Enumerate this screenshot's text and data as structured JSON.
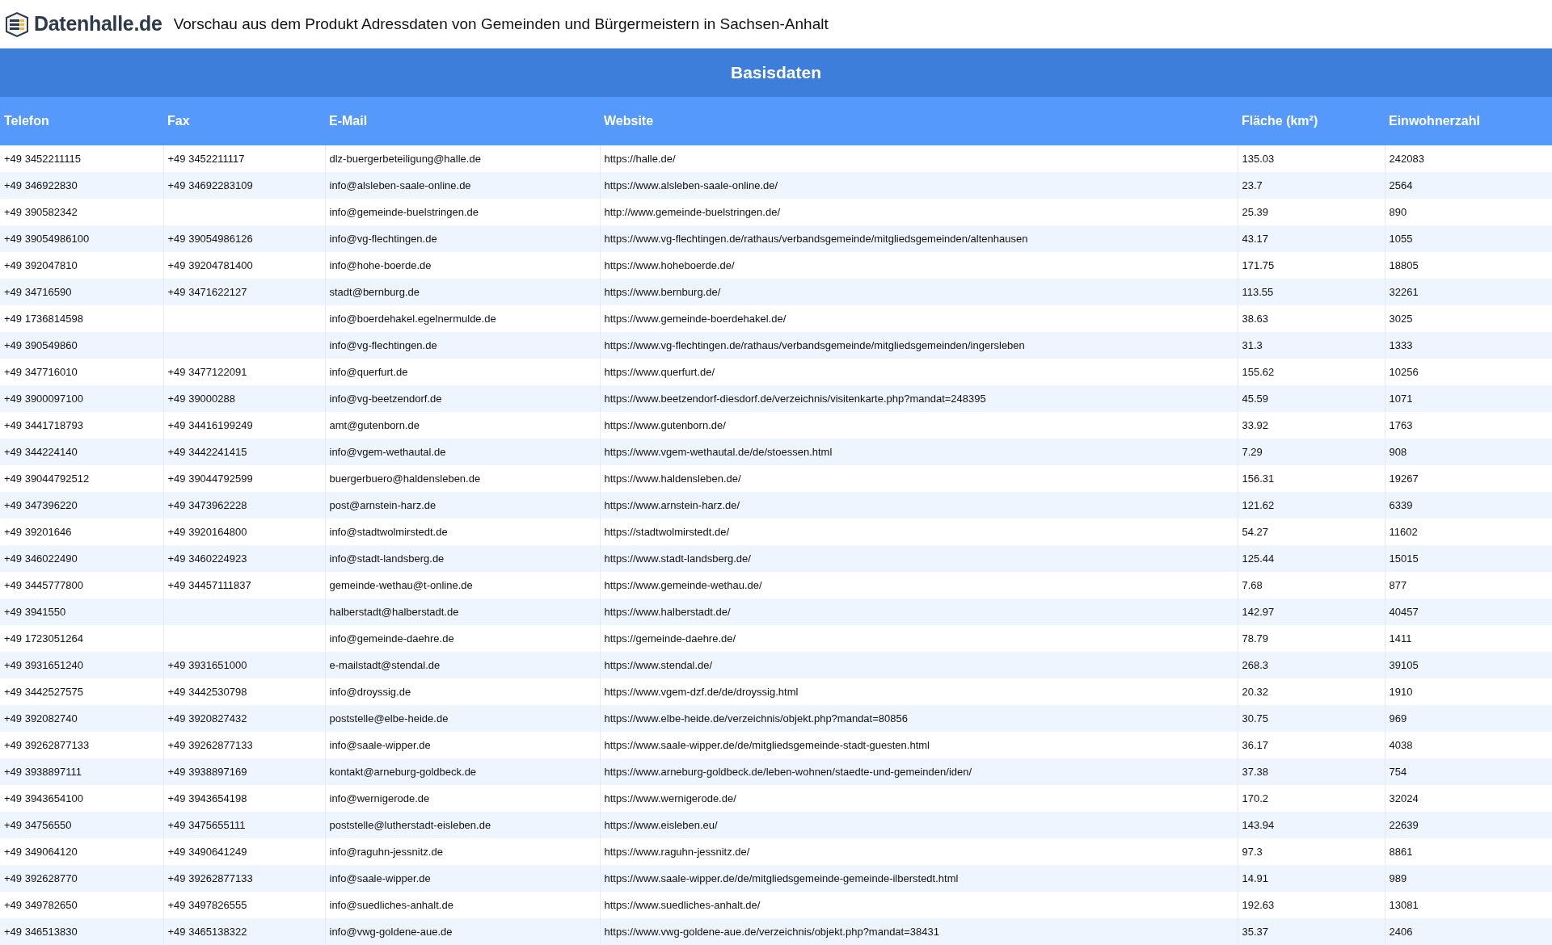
{
  "header": {
    "logo_text": "Datenhalle.de",
    "title": "Vorschau aus dem Produkt Adressdaten von Gemeinden und Bürgermeistern in Sachsen-Anhalt"
  },
  "table": {
    "group_heading": "Basisdaten",
    "columns": [
      "Telefon",
      "Fax",
      "E-Mail",
      "Website",
      "Fläche (km²)",
      "Einwohnerzahl"
    ],
    "rows": [
      {
        "telefon": "+49 3452211115",
        "fax": "+49 3452211117",
        "email": "dlz-buergerbeteiligung@halle.de",
        "website": "https://halle.de/",
        "flaeche": "135.03",
        "einwohner": "242083"
      },
      {
        "telefon": "+49 346922830",
        "fax": "+49 34692283109",
        "email": "info@alsleben-saale-online.de",
        "website": "https://www.alsleben-saale-online.de/",
        "flaeche": "23.7",
        "einwohner": "2564"
      },
      {
        "telefon": "+49 390582342",
        "email": "info@gemeinde-buelstringen.de",
        "website": "http://www.gemeinde-buelstringen.de/",
        "flaeche": "25.39",
        "einwohner": "890"
      },
      {
        "telefon": "+49 39054986100",
        "fax": "+49 39054986126",
        "email": "info@vg-flechtingen.de",
        "website": "https://www.vg-flechtingen.de/rathaus/verbandsgemeinde/mitgliedsgemeinden/altenhausen",
        "flaeche": "43.17",
        "einwohner": "1055"
      },
      {
        "telefon": "+49 392047810",
        "fax": "+49 39204781400",
        "email": "info@hohe-boerde.de",
        "website": "https://www.hoheboerde.de/",
        "flaeche": "171.75",
        "einwohner": "18805"
      },
      {
        "telefon": "+49 34716590",
        "fax": "+49 3471622127",
        "email": "stadt@bernburg.de",
        "website": "https://www.bernburg.de/",
        "flaeche": "113.55",
        "einwohner": "32261"
      },
      {
        "telefon": "+49 1736814598",
        "email": "info@boerdehakel.egelnermulde.de",
        "website": "https://www.gemeinde-boerdehakel.de/",
        "flaeche": "38.63",
        "einwohner": "3025"
      },
      {
        "telefon": "+49 390549860",
        "email": "info@vg-flechtingen.de",
        "website": "https://www.vg-flechtingen.de/rathaus/verbandsgemeinde/mitgliedsgemeinden/ingersleben",
        "flaeche": "31.3",
        "einwohner": "1333"
      },
      {
        "telefon": "+49 347716010",
        "fax": "+49 3477122091",
        "email": "info@querfurt.de",
        "website": "https://www.querfurt.de/",
        "flaeche": "155.62",
        "einwohner": "10256"
      },
      {
        "telefon": "+49 3900097100",
        "fax": "+49 39000288",
        "email": "info@vg-beetzendorf.de",
        "website": "https://www.beetzendorf-diesdorf.de/verzeichnis/visitenkarte.php?mandat=248395",
        "flaeche": "45.59",
        "einwohner": "1071"
      },
      {
        "telefon": "+49 3441718793",
        "fax": "+49 34416199249",
        "email": "amt@gutenborn.de",
        "website": "https://www.gutenborn.de/",
        "flaeche": "33.92",
        "einwohner": "1763"
      },
      {
        "telefon": "+49 344224140",
        "fax": "+49 3442241415",
        "email": "info@vgem-wethautal.de",
        "website": "https://www.vgem-wethautal.de/de/stoessen.html",
        "flaeche": "7.29",
        "einwohner": "908"
      },
      {
        "telefon": "+49 39044792512",
        "fax": "+49 39044792599",
        "email": "buergerbuero@haldensleben.de",
        "website": "https://www.haldensleben.de/",
        "flaeche": "156.31",
        "einwohner": "19267"
      },
      {
        "telefon": "+49 347396220",
        "fax": "+49 3473962228",
        "email": "post@arnstein-harz.de",
        "website": "https://www.arnstein-harz.de/",
        "flaeche": "121.62",
        "einwohner": "6339"
      },
      {
        "telefon": "+49 39201646",
        "fax": "+49 3920164800",
        "email": "info@stadtwolmirstedt.de",
        "website": "https://stadtwolmirstedt.de/",
        "flaeche": "54.27",
        "einwohner": "11602"
      },
      {
        "telefon": "+49 346022490",
        "fax": "+49 3460224923",
        "email": "info@stadt-landsberg.de",
        "website": "https://www.stadt-landsberg.de/",
        "flaeche": "125.44",
        "einwohner": "15015"
      },
      {
        "telefon": "+49 3445777800",
        "fax": "+49 34457111837",
        "email": "gemeinde-wethau@t-online.de",
        "website": "https://www.gemeinde-wethau.de/",
        "flaeche": "7.68",
        "einwohner": "877"
      },
      {
        "telefon": "+49 3941550",
        "email": "halberstadt@halberstadt.de",
        "website": "https://www.halberstadt.de/",
        "flaeche": "142.97",
        "einwohner": "40457"
      },
      {
        "telefon": "+49 1723051264",
        "email": "info@gemeinde-daehre.de",
        "website": "https://gemeinde-daehre.de/",
        "flaeche": "78.79",
        "einwohner": "1411"
      },
      {
        "telefon": "+49 3931651240",
        "fax": "+49 3931651000",
        "email": "e-mailstadt@stendal.de",
        "website": "https://www.stendal.de/",
        "flaeche": "268.3",
        "einwohner": "39105"
      },
      {
        "telefon": "+49 3442527575",
        "fax": "+49 3442530798",
        "email": "info@droyssig.de",
        "website": "https://www.vgem-dzf.de/de/droyssig.html",
        "flaeche": "20.32",
        "einwohner": "1910"
      },
      {
        "telefon": "+49 392082740",
        "fax": "+49 3920827432",
        "email": "poststelle@elbe-heide.de",
        "website": "https://www.elbe-heide.de/verzeichnis/objekt.php?mandat=80856",
        "flaeche": "30.75",
        "einwohner": "969"
      },
      {
        "telefon": "+49 39262877133",
        "fax": "+49 39262877133",
        "email": "info@saale-wipper.de",
        "website": "https://www.saale-wipper.de/de/mitgliedsgemeinde-stadt-guesten.html",
        "flaeche": "36.17",
        "einwohner": "4038"
      },
      {
        "telefon": "+49 3938897111",
        "fax": "+49 3938897169",
        "email": "kontakt@arneburg-goldbeck.de",
        "website": "https://www.arneburg-goldbeck.de/leben-wohnen/staedte-und-gemeinden/iden/",
        "flaeche": "37.38",
        "einwohner": "754"
      },
      {
        "telefon": "+49 3943654100",
        "fax": "+49 3943654198",
        "email": "info@wernigerode.de",
        "website": "https://www.wernigerode.de/",
        "flaeche": "170.2",
        "einwohner": "32024"
      },
      {
        "telefon": "+49 34756550",
        "fax": "+49 3475655111",
        "email": "poststelle@lutherstadt-eisleben.de",
        "website": "https://www.eisleben.eu/",
        "flaeche": "143.94",
        "einwohner": "22639"
      },
      {
        "telefon": "+49 349064120",
        "fax": "+49 3490641249",
        "email": "info@raguhn-jessnitz.de",
        "website": "https://www.raguhn-jessnitz.de/",
        "flaeche": "97.3",
        "einwohner": "8861"
      },
      {
        "telefon": "+49 392628770",
        "fax": "+49 39262877133",
        "email": "info@saale-wipper.de",
        "website": "https://www.saale-wipper.de/de/mitgliedsgemeinde-gemeinde-ilberstedt.html",
        "flaeche": "14.91",
        "einwohner": "989"
      },
      {
        "telefon": "+49 349782650",
        "fax": "+49 3497826555",
        "email": "info@suedliches-anhalt.de",
        "website": "https://www.suedliches-anhalt.de/",
        "flaeche": "192.63",
        "einwohner": "13081"
      },
      {
        "telefon": "+49 346513830",
        "fax": "+49 3465138322",
        "email": "info@vwg-goldene-aue.de",
        "website": "https://www.vwg-goldene-aue.de/verzeichnis/objekt.php?mandat=38431",
        "flaeche": "35.37",
        "einwohner": "2406"
      }
    ]
  }
}
